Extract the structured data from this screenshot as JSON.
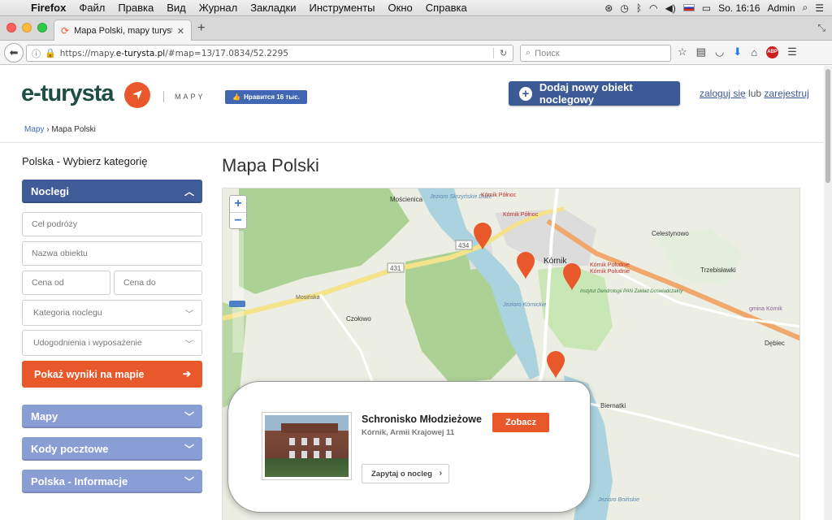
{
  "menubar": {
    "app": "Firefox",
    "items": [
      "Файл",
      "Правка",
      "Вид",
      "Журнал",
      "Закладки",
      "Инструменты",
      "Окно",
      "Справка"
    ],
    "clock": "So. 16:16",
    "user": "Admin"
  },
  "browser": {
    "tab_title": "Mapa Polski, mapy turysty...",
    "url_prefix": "https://mapy.",
    "url_domain": "e-turysta.pl",
    "url_rest": "/#map=13/17.0834/52.2295",
    "search_placeholder": "Поиск",
    "adblock_label": "ABP"
  },
  "header": {
    "logo": "e-turysta",
    "logo_sub": "MAPY",
    "fb_like": "Нравится 16 тыс.",
    "add_button": "Dodaj nowy obiekt noclegowy",
    "login": "zaloguj się",
    "or": "lub",
    "register": "zarejestruj"
  },
  "breadcrumb": {
    "home": "Mapy",
    "sep": "›",
    "current": "Mapa Polski"
  },
  "sidebar": {
    "title": "Polska - Wybierz kategorię",
    "noclegi": "Noclegi",
    "destination_placeholder": "Cel podróży",
    "name_placeholder": "Nazwa obiektu",
    "price_from": "Cena od",
    "price_to": "Cena do",
    "category": "Kategoria noclegu",
    "amenities": "Udogodnienia i wyposażenie",
    "show_button": "Pokaż wyniki na mapie",
    "sections": [
      "Mapy",
      "Kody pocztowe",
      "Polska - Informacje"
    ]
  },
  "main": {
    "title": "Mapa Polski"
  },
  "map": {
    "place_labels": [
      "Mościenica",
      "Jezioro Skrzyńskie Duże",
      "Kórnik Północ",
      "Kórnik Północ",
      "Kórnik",
      "Kórnik Południe",
      "Kórnik Południe",
      "Instytut Dendrologii PAN Zakład Doświadczalny",
      "Jezioro Kórnickie",
      "Czołowo",
      "Celestynowo",
      "Trzebisławki",
      "Dębiec",
      "Biernatki",
      "Jezioro Bnińskie",
      "Mosińska",
      "gmina Kórnik"
    ],
    "road_shields": [
      "434",
      "431"
    ],
    "popup": {
      "name": "Schronisko Młodzieżowe",
      "address": "Kórnik, Armii Krajowej 11",
      "see_button": "Zobacz",
      "ask_button": "Zapytaj o nocleg"
    }
  },
  "colors": {
    "brand_dark": "#1e4e43",
    "accent": "#e8582b",
    "nav_blue": "#3f5b98",
    "nav_light": "#8a9ed6"
  }
}
